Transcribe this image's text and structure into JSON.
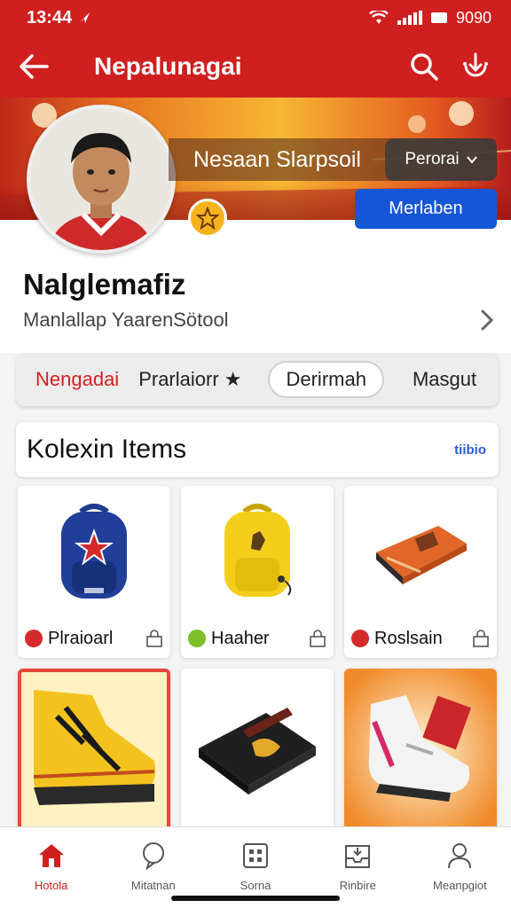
{
  "status": {
    "time": "13:44",
    "battery_text": "9090"
  },
  "header": {
    "title": "Nepalunagai"
  },
  "profile": {
    "display_name": "Nesaan Slarpsoil",
    "pill_label": "Perorai",
    "follow_label": "Merlaben",
    "username": "Nalglemafiz",
    "subtitle": "Manlallap YaarenSötool"
  },
  "tabs": {
    "items": [
      {
        "label": "Nengadai",
        "active": true
      },
      {
        "label": "Prarlaiorr ★",
        "active": false
      },
      {
        "label": "Derirmah",
        "active": false,
        "pill": true
      },
      {
        "label": "Masgut",
        "active": false
      }
    ]
  },
  "collection": {
    "title": "Kolexin Items",
    "link": "tiibio",
    "items": [
      {
        "label": "Plraioarl",
        "chip_color": "#d42a2a",
        "icon": "backpack-blue-icon"
      },
      {
        "label": "Haaher",
        "chip_color": "#7cbf2a",
        "icon": "backpack-yellow-icon"
      },
      {
        "label": "Roslsain",
        "chip_color": "#d42a2a",
        "icon": "wallet-orange-icon"
      },
      {
        "label": "",
        "icon": "boot-yellow-icon"
      },
      {
        "label": "",
        "icon": "wallet-black-icon"
      },
      {
        "label": "",
        "icon": "sneaker-white-icon"
      }
    ]
  },
  "bottom_nav": {
    "items": [
      {
        "label": "Hotola",
        "icon": "home-icon",
        "active": true
      },
      {
        "label": "Mitatnan",
        "icon": "chat-icon",
        "active": false
      },
      {
        "label": "Sorna",
        "icon": "grid-icon",
        "active": false
      },
      {
        "label": "Rinbire",
        "icon": "inbox-icon",
        "active": false
      },
      {
        "label": "Meanpgiot",
        "icon": "person-icon",
        "active": false
      }
    ]
  },
  "colors": {
    "brand_red": "#cf1f1f",
    "action_blue": "#1556d6"
  }
}
